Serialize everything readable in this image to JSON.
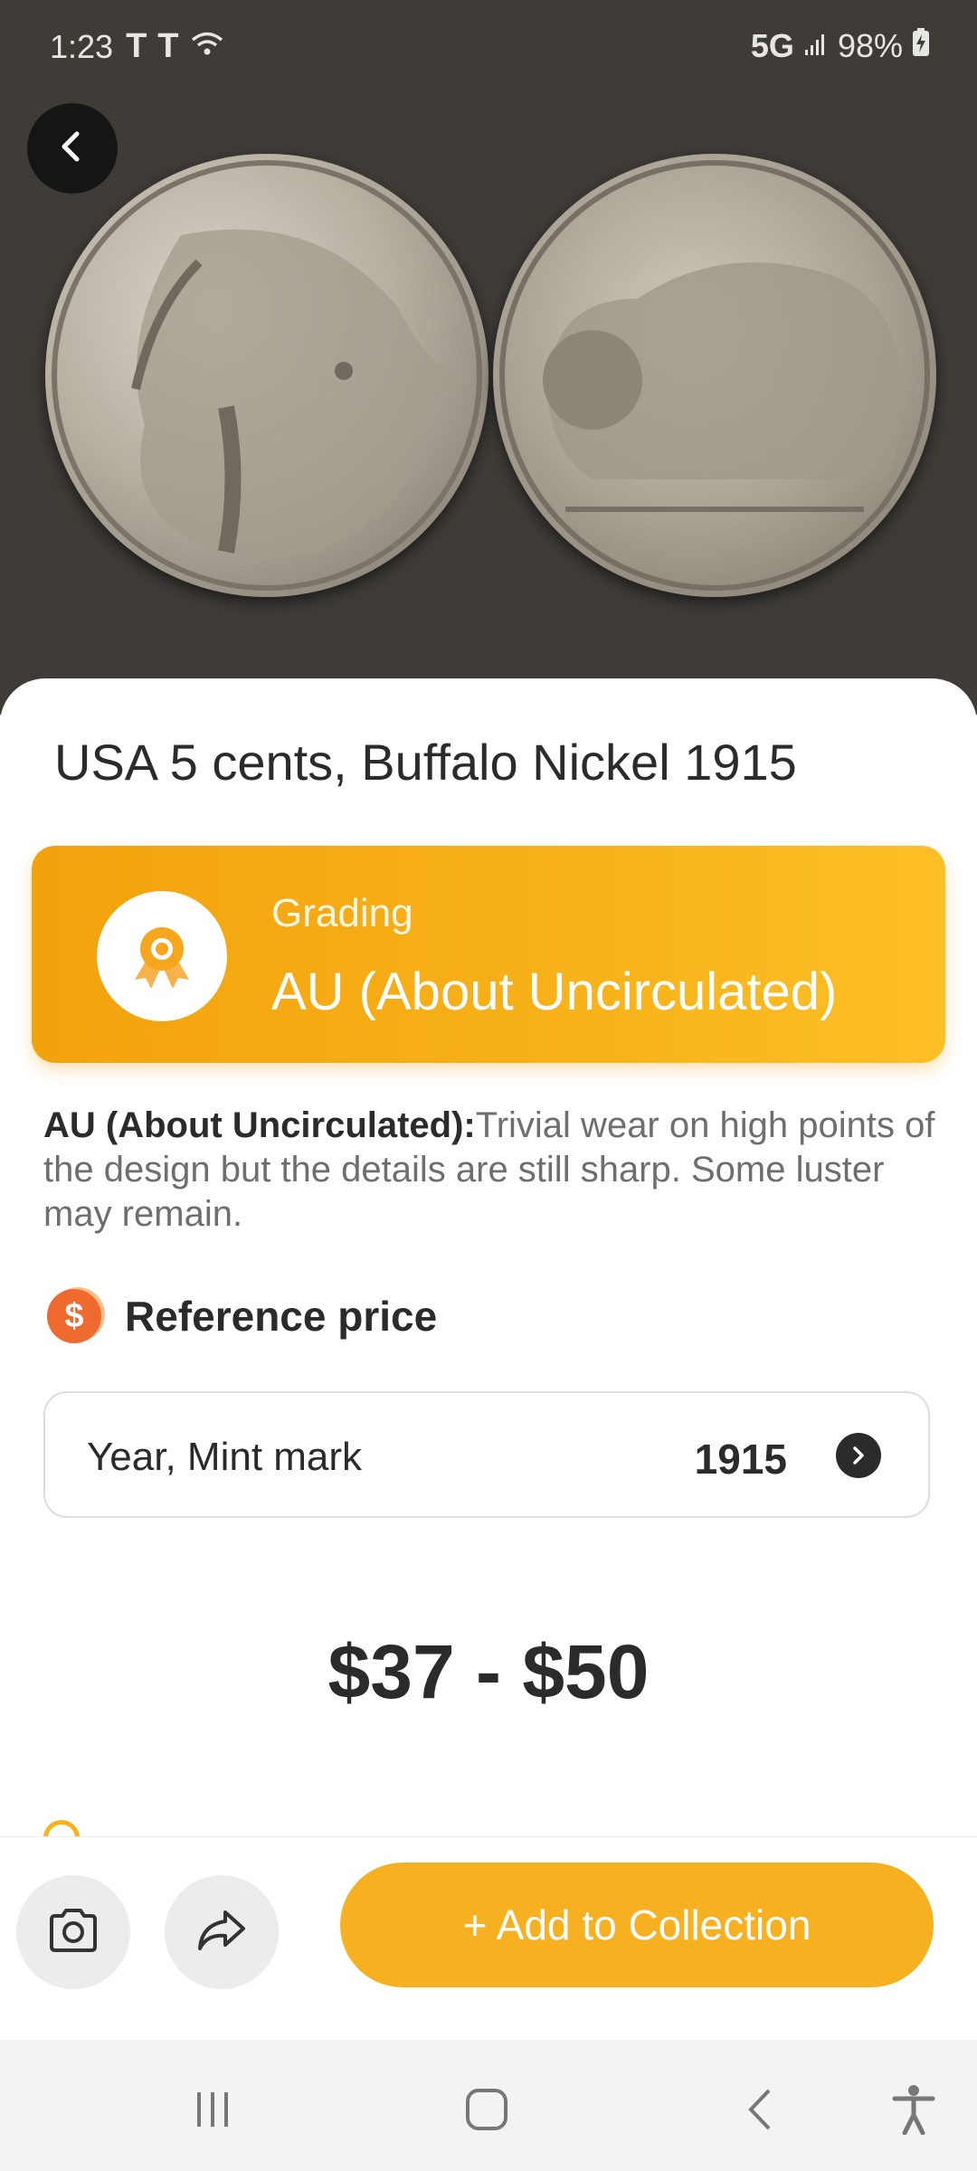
{
  "status_bar": {
    "time": "1:23",
    "carrier_icons": [
      "T",
      "T"
    ],
    "network": "5G",
    "battery": "98%"
  },
  "coin": {
    "title": "USA 5 cents, Buffalo Nickel 1915"
  },
  "grading": {
    "label": "Grading",
    "value": "AU (About Uncirculated)"
  },
  "description": {
    "term": "AU (About Uncirculated):",
    "text": "Trivial wear on high points of the design but the details are still sharp. Some luster may remain."
  },
  "reference_price": {
    "label": "Reference price",
    "icon_symbol": "$"
  },
  "selector": {
    "label": "Year, Mint mark",
    "value": "1915"
  },
  "price_range": "$37 - $50",
  "actions": {
    "add_label": "+ Add to Collection"
  },
  "colors": {
    "accent": "#f7b020",
    "grading_gradient_start": "#f2a20c",
    "grading_gradient_end": "#fcbf25",
    "price_icon": "#ef6a2f",
    "hero_background": "#3f3c38"
  },
  "icons": {
    "back": "chevron-left-icon",
    "camera": "camera-icon",
    "share": "share-icon",
    "award": "award-ribbon-icon",
    "arrow": "chevron-right-icon"
  }
}
